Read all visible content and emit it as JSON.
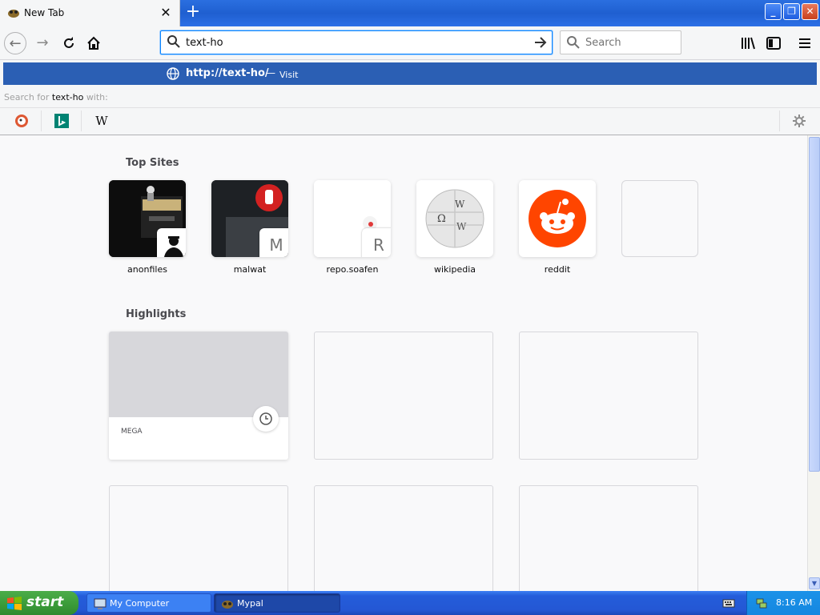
{
  "tab": {
    "title": "New Tab"
  },
  "toolbar": {
    "url_value": "text-ho",
    "search_placeholder": "Search"
  },
  "popup": {
    "suggestion_url": "http://text-ho/",
    "suggestion_separator": "—",
    "suggestion_action": "Visit",
    "search_for_prefix": "Search for",
    "search_for_query": "text-ho",
    "search_for_suffix": "with:",
    "engines": [
      "duckduckgo-icon",
      "bing-icon",
      "wikipedia-icon"
    ]
  },
  "content": {
    "top_sites_title": "Top Sites",
    "top_sites": [
      {
        "label": "anonfiles"
      },
      {
        "label": "malwat",
        "badge": "M"
      },
      {
        "label": "repo.soafen",
        "badge": "R"
      },
      {
        "label": "wikipedia"
      },
      {
        "label": "reddit"
      },
      {
        "label": ""
      }
    ],
    "highlights_title": "Highlights",
    "highlights": [
      {
        "label": "MEGA"
      }
    ]
  },
  "taskbar": {
    "start_label": "start",
    "tasks": [
      {
        "label": "My Computer"
      },
      {
        "label": "Mypal"
      }
    ],
    "clock": "8:16 AM"
  },
  "colors": {
    "accent": "#0a84ff",
    "suggestion_bg": "#2b5fb4",
    "reddit": "#ff4500"
  }
}
